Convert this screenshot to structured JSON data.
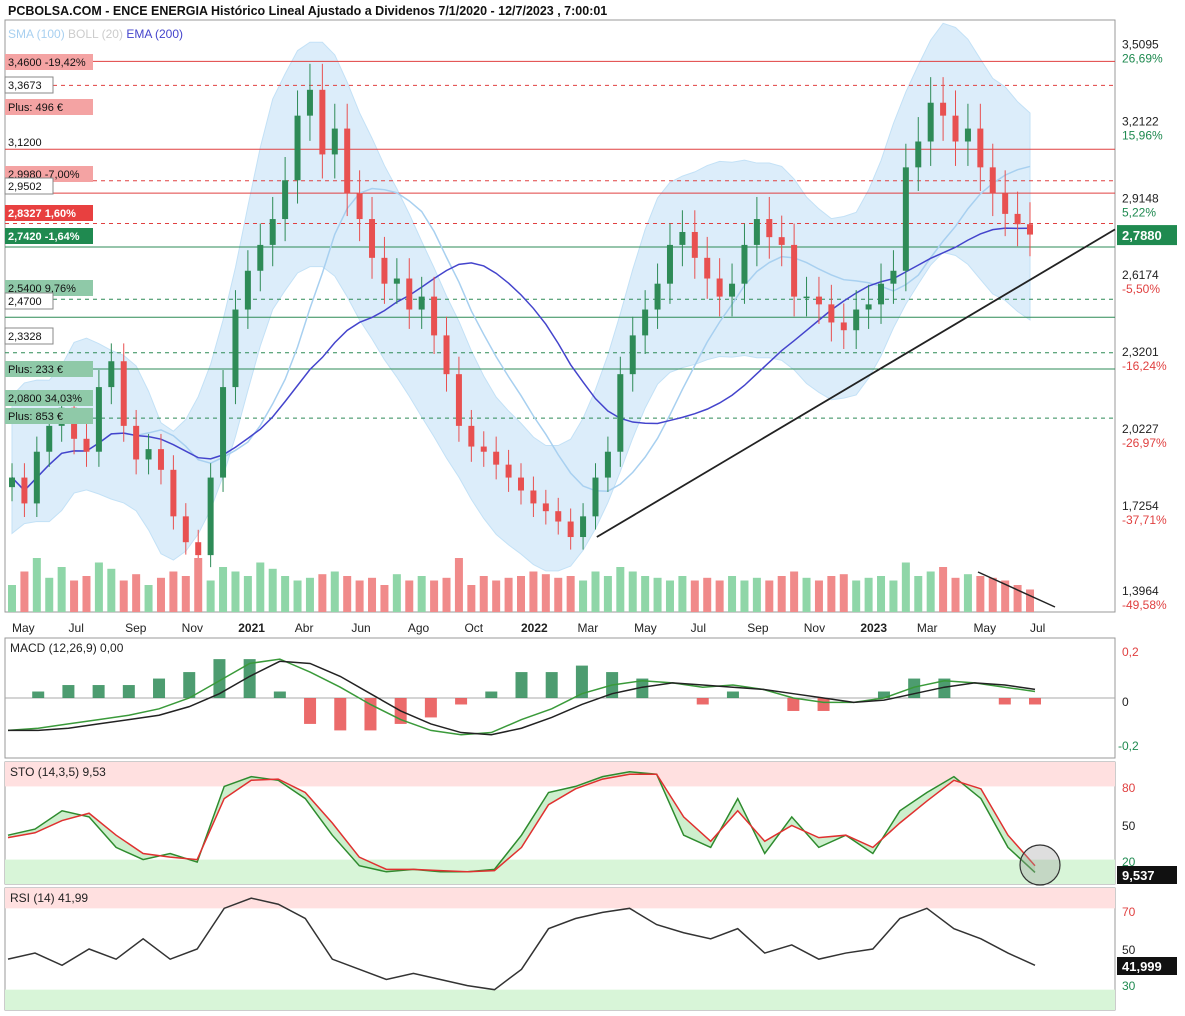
{
  "title": "PCBOLSA.COM - ENCE ENERGIA Histórico Lineal Ajustado a Dividenos 7/1/2020 - 12/7/2023 , 7:00:01",
  "colors": {
    "up": "#2e8b57",
    "down": "#e85050",
    "sma": "#a8d0f0",
    "boll": "#cccccc",
    "ema": "#4444cc",
    "band": "#d6ebfa",
    "resistance": "#e04040",
    "support": "#2e8b57",
    "last_price_bg": "#1f8a50"
  },
  "legend": {
    "sma": "SMA (100)",
    "boll": "BOLL (20)",
    "ema": "EMA (200)"
  },
  "x_ticks": [
    "May",
    "Jul",
    "Sep",
    "Nov",
    "2021",
    "Abr",
    "Jun",
    "Ago",
    "Oct",
    "2022",
    "Mar",
    "May",
    "Jul",
    "Sep",
    "Nov",
    "2023",
    "Mar",
    "May",
    "Jul"
  ],
  "y_ticks": [
    {
      "price": "3,5095",
      "pct": "26,69%",
      "sign": "pos"
    },
    {
      "price": "3,2122",
      "pct": "15,96%",
      "sign": "pos"
    },
    {
      "price": "2,9148",
      "pct": "5,22%",
      "sign": "pos"
    },
    {
      "price": "2,6174",
      "pct": "-5,50%",
      "sign": "neg"
    },
    {
      "price": "2,3201",
      "pct": "-16,24%",
      "sign": "neg"
    },
    {
      "price": "2,0227",
      "pct": "-26,97%",
      "sign": "neg"
    },
    {
      "price": "1,7254",
      "pct": "-37,71%",
      "sign": "neg"
    },
    {
      "price": "1,3964",
      "pct": "-49,58%",
      "sign": "neg"
    }
  ],
  "last_price": "2,7880",
  "left_labels": [
    {
      "text": "3,4600  -19,42%",
      "kind": "res"
    },
    {
      "text": "3,3673",
      "kind": "box"
    },
    {
      "text": "Plus: 496 €",
      "kind": "res"
    },
    {
      "text": "3,1200",
      "kind": "plain"
    },
    {
      "text": "2,9980  -7,00%",
      "kind": "res"
    },
    {
      "text": "2,9502",
      "kind": "box"
    },
    {
      "text": "2,8327  1,60%",
      "kind": "resdark"
    },
    {
      "text": "2,7420  -1,64%",
      "kind": "supdark"
    },
    {
      "text": "2,5400  9,76%",
      "kind": "sup"
    },
    {
      "text": "2,4700",
      "kind": "box"
    },
    {
      "text": "2,3328",
      "kind": "box"
    },
    {
      "text": "Plus: 233 €",
      "kind": "sup"
    },
    {
      "text": "2,0800  34,03%",
      "kind": "sup"
    },
    {
      "text": "Plus: 853 €",
      "kind": "sup"
    }
  ],
  "macd": {
    "label": "MACD (12,26,9)",
    "value": "0,00",
    "ticks": [
      "0,2",
      "0",
      "-0,2"
    ]
  },
  "sto": {
    "label": "STO (14,3,5)",
    "value": "9,53",
    "ticks": [
      "80",
      "50",
      "20"
    ],
    "last": "9,537"
  },
  "rsi": {
    "label": "RSI (14)",
    "value": "41,99",
    "ticks": [
      "70",
      "50",
      "30"
    ],
    "last": "41,999"
  },
  "chart_data": [
    {
      "type": "candlestick",
      "title": "ENCE ENERGIA",
      "x_range": [
        "2020-04-01",
        "2023-07-12"
      ],
      "ylim": [
        1.33,
        3.62
      ],
      "resistance_levels": [
        3.46,
        3.3673,
        3.12,
        2.998,
        2.9502,
        2.8327
      ],
      "support_levels": [
        2.742,
        2.54,
        2.47,
        2.3328,
        2.27,
        2.08
      ],
      "trendline": {
        "from": [
          "2022-01-20",
          1.62
        ],
        "to": [
          "2023-07-31",
          2.81
        ]
      },
      "close_series": [
        1.85,
        1.75,
        1.95,
        2.05,
        2.12,
        2.0,
        1.95,
        2.2,
        2.3,
        2.05,
        1.92,
        1.96,
        1.88,
        1.7,
        1.6,
        1.55,
        1.85,
        2.2,
        2.5,
        2.65,
        2.75,
        2.85,
        3.0,
        3.25,
        3.35,
        3.1,
        3.2,
        2.95,
        2.85,
        2.7,
        2.6,
        2.62,
        2.5,
        2.55,
        2.4,
        2.25,
        2.05,
        1.97,
        1.95,
        1.9,
        1.85,
        1.8,
        1.75,
        1.72,
        1.68,
        1.62,
        1.7,
        1.85,
        1.95,
        2.25,
        2.4,
        2.5,
        2.6,
        2.75,
        2.8,
        2.7,
        2.62,
        2.55,
        2.6,
        2.75,
        2.85,
        2.78,
        2.75,
        2.55,
        2.55,
        2.52,
        2.45,
        2.42,
        2.5,
        2.52,
        2.6,
        2.65,
        3.05,
        3.15,
        3.3,
        3.25,
        3.15,
        3.2,
        3.05,
        2.95,
        2.87,
        2.83,
        2.79
      ],
      "volume": [
        30,
        45,
        60,
        38,
        50,
        35,
        40,
        55,
        48,
        35,
        42,
        30,
        38,
        45,
        40,
        60,
        35,
        50,
        45,
        40,
        55,
        48,
        40,
        35,
        38,
        42,
        45,
        40,
        35,
        38,
        30,
        42,
        35,
        40,
        35,
        38,
        60,
        30,
        40,
        35,
        38,
        40,
        45,
        42,
        38,
        40,
        35,
        45,
        40,
        50,
        45,
        40,
        38,
        35,
        40,
        35,
        38,
        35,
        40,
        35,
        38,
        35,
        40,
        45,
        38,
        35,
        40,
        42,
        35,
        38,
        40,
        35,
        55,
        40,
        45,
        50,
        38,
        42,
        40,
        38,
        35,
        30,
        25
      ]
    },
    {
      "type": "line",
      "name": "MACD (12,26,9)",
      "ylim": [
        -0.25,
        0.25
      ],
      "macd": [
        -0.15,
        -0.14,
        -0.12,
        -0.1,
        -0.08,
        -0.05,
        0.0,
        0.08,
        0.16,
        0.18,
        0.12,
        0.05,
        -0.03,
        -0.1,
        -0.15,
        -0.17,
        -0.16,
        -0.1,
        -0.05,
        0.02,
        0.06,
        0.08,
        0.07,
        0.05,
        0.06,
        0.04,
        0.0,
        -0.02,
        -0.02,
        0.0,
        0.05,
        0.08,
        0.07,
        0.05,
        0.03
      ],
      "signal": [
        -0.15,
        -0.15,
        -0.14,
        -0.12,
        -0.1,
        -0.08,
        -0.04,
        0.02,
        0.1,
        0.17,
        0.16,
        0.1,
        0.02,
        -0.06,
        -0.12,
        -0.16,
        -0.17,
        -0.14,
        -0.09,
        -0.03,
        0.02,
        0.05,
        0.07,
        0.06,
        0.05,
        0.04,
        0.02,
        0.0,
        -0.02,
        -0.01,
        0.02,
        0.05,
        0.07,
        0.06,
        0.04
      ]
    },
    {
      "type": "line",
      "name": "STO (14,3,5)",
      "ylim": [
        0,
        100
      ],
      "k": [
        40,
        45,
        60,
        55,
        30,
        20,
        25,
        18,
        80,
        88,
        85,
        70,
        40,
        15,
        10,
        12,
        10,
        10,
        12,
        40,
        75,
        80,
        88,
        92,
        90,
        40,
        30,
        70,
        25,
        55,
        30,
        40,
        25,
        60,
        75,
        88,
        70,
        30,
        9.5
      ],
      "d": [
        38,
        42,
        52,
        58,
        40,
        25,
        22,
        20,
        70,
        85,
        86,
        75,
        50,
        22,
        12,
        12,
        11,
        10,
        11,
        30,
        65,
        78,
        86,
        90,
        90,
        55,
        35,
        60,
        35,
        48,
        38,
        40,
        30,
        50,
        68,
        85,
        78,
        40,
        15
      ]
    },
    {
      "type": "line",
      "name": "RSI (14)",
      "ylim": [
        20,
        80
      ],
      "values": [
        45,
        48,
        42,
        50,
        45,
        55,
        45,
        50,
        70,
        75,
        72,
        65,
        45,
        40,
        35,
        38,
        35,
        32,
        30,
        40,
        60,
        65,
        68,
        70,
        62,
        58,
        55,
        60,
        48,
        52,
        45,
        48,
        50,
        65,
        70,
        60,
        55,
        48,
        42
      ]
    }
  ]
}
